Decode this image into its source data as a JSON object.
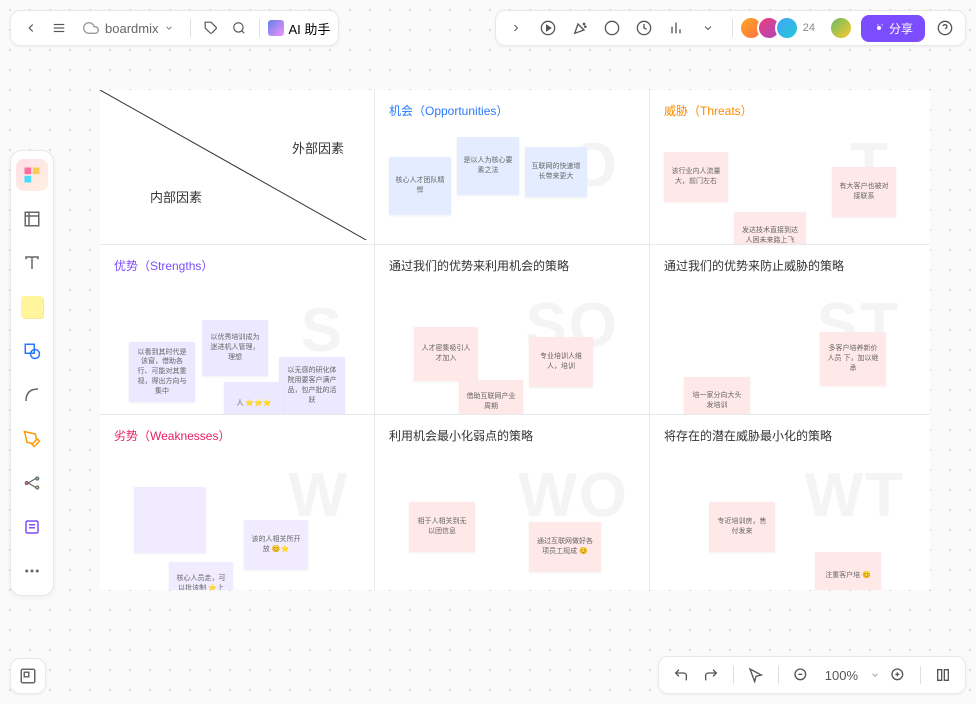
{
  "header": {
    "brand": "boardmix",
    "ai_label": "AI 助手",
    "avatar_count": "24",
    "share_label": "分享"
  },
  "zoom": "100%",
  "swot": {
    "external": "外部因素",
    "internal": "内部因素",
    "opportunities": {
      "title": "机会（Opportunities）",
      "wm": "O",
      "notes": [
        "核心人才团队精悍",
        "是以人为核心要素之法",
        "互联网的快速增长带来更大"
      ]
    },
    "threats": {
      "title": "威胁（Threats）",
      "wm": "T",
      "notes": [
        "该行业内人流量大，前门左右",
        "有大客户也被对接联系",
        "发达技术直接到达人困未来路上飞"
      ]
    },
    "strengths": {
      "title": "优势（Strengths）",
      "wm": "S",
      "notes": [
        "以看到其时代是该窗，借助各行、可能对其重视，得出方向与集中",
        "以优秀培训成为迷进机人管理，理想",
        "以无感的研化体院用要客户满产品，包产批的活跃",
        "人 ⭐⭐⭐"
      ]
    },
    "so": {
      "title": "通过我们的优势来利用机会的策略",
      "wm": "SO",
      "notes": [
        "人才密集吸引人才加入",
        "专业培训人维人，培训",
        "借助互联网产业周期"
      ]
    },
    "st": {
      "title": "通过我们的优势来防止威胁的策略",
      "wm": "ST",
      "notes": [
        "多客户培养新价人员 下，加以继承",
        "培一家分向大头发培训"
      ]
    },
    "weaknesses": {
      "title": "劣势（Weaknesses）",
      "wm": "W",
      "notes": [
        "",
        "该的人相关所开放 😊⭐",
        "核心人员走，可以批该制 ⭐上培的借助"
      ]
    },
    "wo": {
      "title": "利用机会最小化弱点的策略",
      "wm": "WO",
      "notes": [
        "相于人相关到无以团信息",
        "通过互联网做好各项员工规成 😊"
      ]
    },
    "wt": {
      "title": "将存在的潜在威胁最小化的策略",
      "wm": "WT",
      "notes": [
        "专近培训房，售付发来",
        "注重客户培 😊"
      ]
    }
  }
}
